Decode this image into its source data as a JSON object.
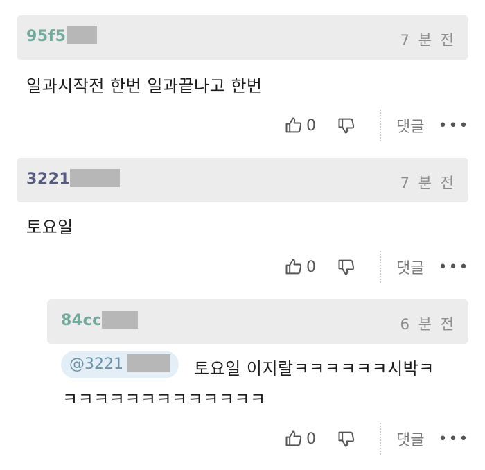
{
  "comments": [
    {
      "username": "95f5",
      "time": "7 분 전",
      "text": "일과시작전 한번 일과끝나고 한번",
      "likes": "0",
      "reply_label": "댓글",
      "more": "•••"
    },
    {
      "username": "3221",
      "time": "7 분 전",
      "text": "토요일",
      "likes": "0",
      "reply_label": "댓글",
      "more": "•••"
    }
  ],
  "reply": {
    "username": "84cc",
    "time": "6 분 전",
    "mention": "@3221",
    "text_line1": "토요일 이지랄ㅋㅋㅋㅋㅋㅋ시박ㅋ",
    "text_line2": "ㅋㅋㅋㅋㅋㅋㅋㅋㅋㅋㅋㅋㅋ",
    "likes": "0",
    "reply_label": "댓글",
    "more": "•••"
  },
  "colors": {
    "username_teal": "#74a99b",
    "username_purple": "#585a7e",
    "mention_bg": "#e3eef7",
    "header_bg": "#ececec"
  },
  "icons": [
    "thumbs-up-icon",
    "thumbs-down-icon",
    "more-dots-icon"
  ]
}
